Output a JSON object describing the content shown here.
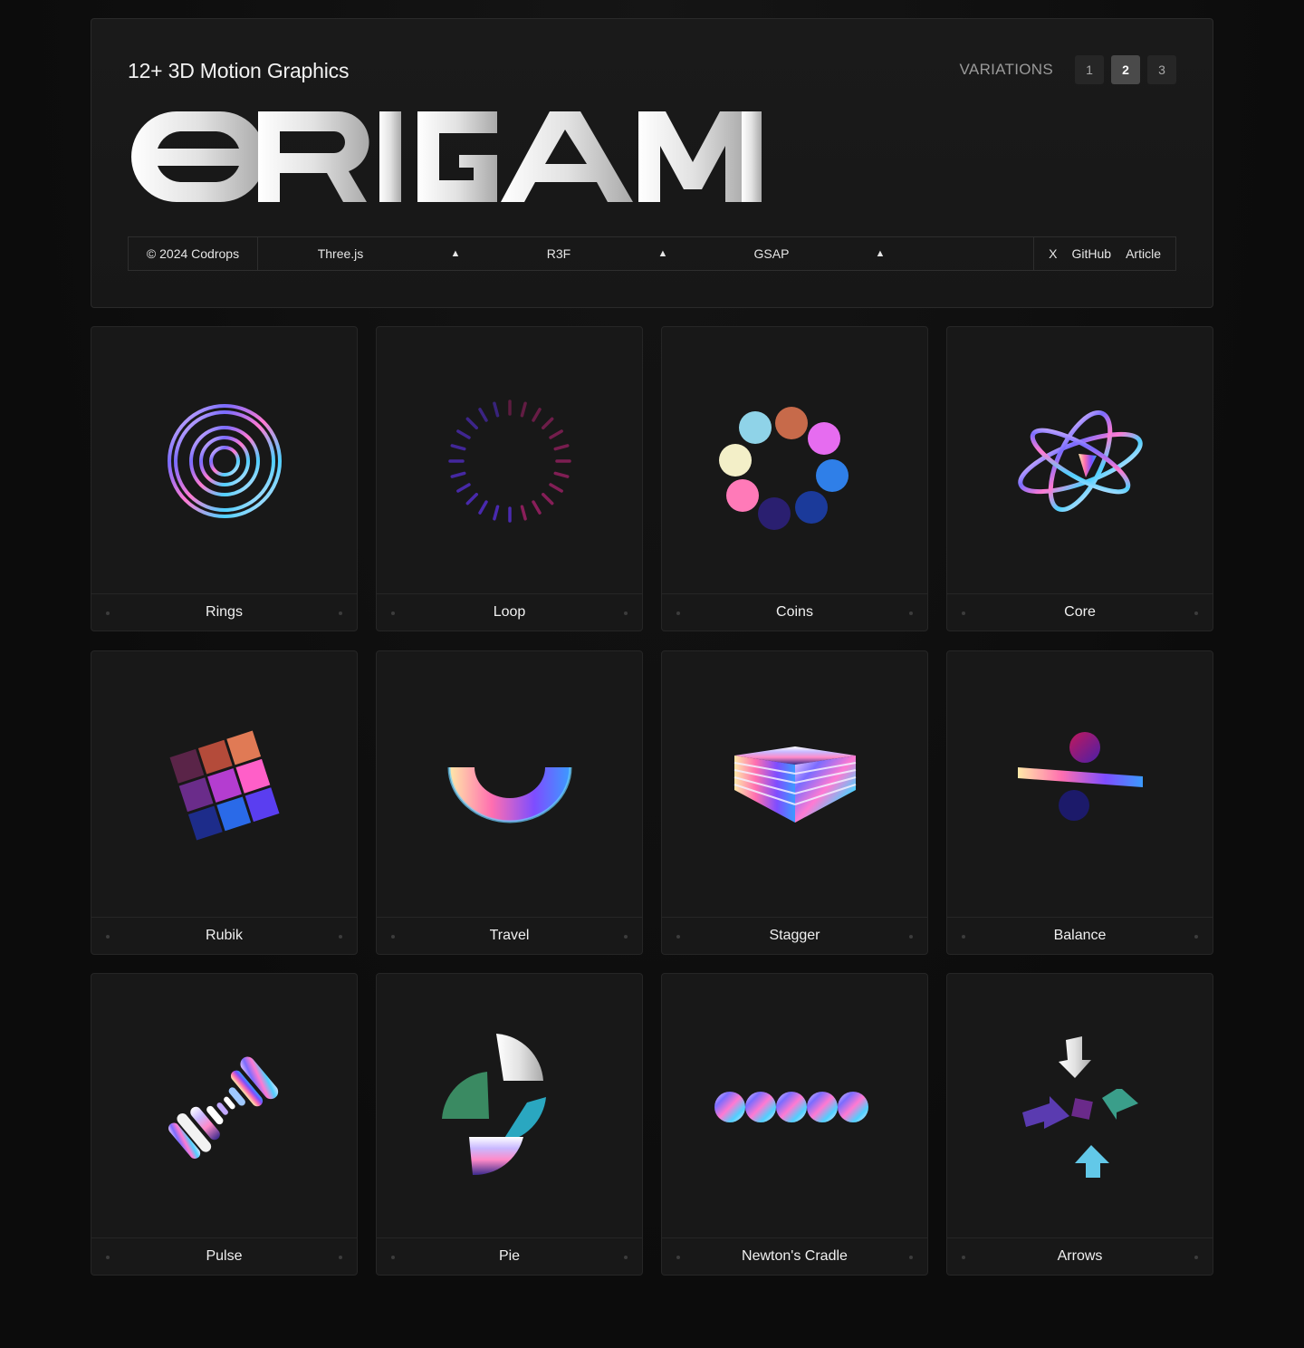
{
  "header": {
    "subtitle": "12+ 3D Motion Graphics",
    "logo_text": "ORIGAMI",
    "variations_label": "VARIATIONS",
    "variations": [
      "1",
      "2",
      "3"
    ],
    "active_variation": "2"
  },
  "toolbar": {
    "copyright": "© 2024 Codrops",
    "tech": [
      "Three.js",
      "R3F",
      "GSAP"
    ],
    "triangle": "▲",
    "links": [
      "X",
      "GitHub",
      "Article"
    ]
  },
  "cards": [
    {
      "title": "Rings",
      "icon": "rings-icon"
    },
    {
      "title": "Loop",
      "icon": "loop-icon"
    },
    {
      "title": "Coins",
      "icon": "coins-icon"
    },
    {
      "title": "Core",
      "icon": "core-icon"
    },
    {
      "title": "Rubik",
      "icon": "rubik-icon"
    },
    {
      "title": "Travel",
      "icon": "travel-icon"
    },
    {
      "title": "Stagger",
      "icon": "stagger-icon"
    },
    {
      "title": "Balance",
      "icon": "balance-icon"
    },
    {
      "title": "Pulse",
      "icon": "pulse-icon"
    },
    {
      "title": "Pie",
      "icon": "pie-icon"
    },
    {
      "title": "Newton's Cradle",
      "icon": "newtons-cradle-icon"
    },
    {
      "title": "Arrows",
      "icon": "arrows-icon"
    }
  ],
  "colors": {
    "background": "#0d0d0d",
    "panel": "#181818",
    "border": "#262626",
    "text": "#f0f0f0",
    "muted": "#9a9a9a"
  }
}
